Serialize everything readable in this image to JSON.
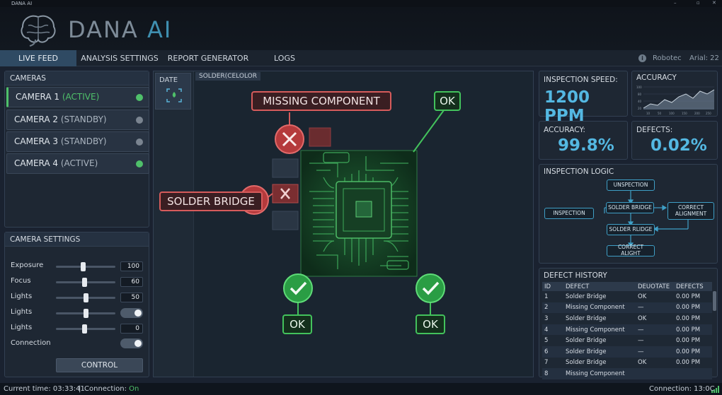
{
  "window": {
    "title": "DANA AI",
    "controls": [
      "–",
      "▫",
      "✕"
    ]
  },
  "brand": {
    "part1": "DANA ",
    "part2": "AI"
  },
  "menu": {
    "items": [
      "LIVE FEED",
      "ANALYSIS SETTINGS",
      "REPORT GENERATOR",
      "LOGS"
    ],
    "right_user": "Robotec",
    "right_font": "Arial: 22"
  },
  "cameras": {
    "title": "CAMERAS",
    "items": [
      {
        "name": "CAMERA 1",
        "status": "(ACTIVE)"
      },
      {
        "name": "CAMERA 2",
        "status": "(STANDBY)"
      },
      {
        "name": "CAMERA 3",
        "status": "(STANDBY)"
      },
      {
        "name": "CAMERA 4",
        "status": "(ACTIVE)"
      }
    ]
  },
  "camera_settings": {
    "title": "CAMERA SETTINGS",
    "rows": [
      {
        "label": "Exposure",
        "value": "100",
        "level": 0.45
      },
      {
        "label": "Focus",
        "value": "60",
        "level": 0.48
      },
      {
        "label": "Lights",
        "value": "50",
        "level": 0.5
      },
      {
        "label": "Lights",
        "value": "",
        "level": 0.5
      },
      {
        "label": "Lights",
        "value": "0",
        "level": 0.48
      }
    ],
    "connection_label": "Connection",
    "control_button": "CONTROL"
  },
  "feed": {
    "date_tab": "DATE",
    "source_tab": "SOLDER(CELOLOR",
    "callout_missing": "MISSING COMPONENT",
    "callout_solder": "SOLDER BRIDGE",
    "ok_top": "OK",
    "ok_left": "OK",
    "ok_right": "OK"
  },
  "metrics": {
    "speed_label": "INSPECTION SPEED:",
    "speed_value": "1200 PPM",
    "accuracy_chart_label": "ACCURACY",
    "accuracy_label": "ACCURACY:",
    "accuracy_value": "99.8%",
    "defects_label": "DEFECTS:",
    "defects_value": "0.02%"
  },
  "logic": {
    "title": "INSPECTION LOGIC",
    "nodes": {
      "unspection": "UNSPECTION",
      "inspection": "INSPECTION",
      "solder_bridge": "SOLDER BRIDGE",
      "correct_alignment": "CORRECT ALIGNMENT",
      "solder_rldge": "SOLDER RLIDGE",
      "correct_alight": "CORRECT ALIGHT"
    }
  },
  "history": {
    "title": "DEFECT HISTORY",
    "columns": [
      "ID",
      "DEFECT",
      "DEUOTATE",
      "DEFECTS"
    ],
    "rows": [
      {
        "id": "1",
        "defect": "Solder Bridge",
        "status": "OK",
        "time": "0.00 PM"
      },
      {
        "id": "2",
        "defect": "Missing Component",
        "status": "—",
        "time": "0.00 PM"
      },
      {
        "id": "3",
        "defect": "Solder Bridge",
        "status": "OK",
        "time": "0.00 PM"
      },
      {
        "id": "4",
        "defect": "Missing Component",
        "status": "—",
        "time": "0.00 PM"
      },
      {
        "id": "5",
        "defect": "Solder Bridge",
        "status": "—",
        "time": "0.00 PM"
      },
      {
        "id": "6",
        "defect": "Solder Bridge",
        "status": "—",
        "time": "0.00 PM"
      },
      {
        "id": "7",
        "defect": "Solder Bridge",
        "status": "OK",
        "time": "0.00 PM"
      },
      {
        "id": "8",
        "defect": "Missing Component",
        "status": "",
        "time": ""
      }
    ]
  },
  "status": {
    "current_time_label": "Current time: ",
    "current_time": "03:33:41",
    "separator": "|",
    "connection_label": "Connection: ",
    "connection_value": "On",
    "connection_right": "Connection: 13:0C"
  },
  "colors": {
    "active": "#4fc06a",
    "standby": "#7a8490",
    "accent": "#54b8e2",
    "alert": "#d65b5b",
    "ok": "#43c25c"
  }
}
